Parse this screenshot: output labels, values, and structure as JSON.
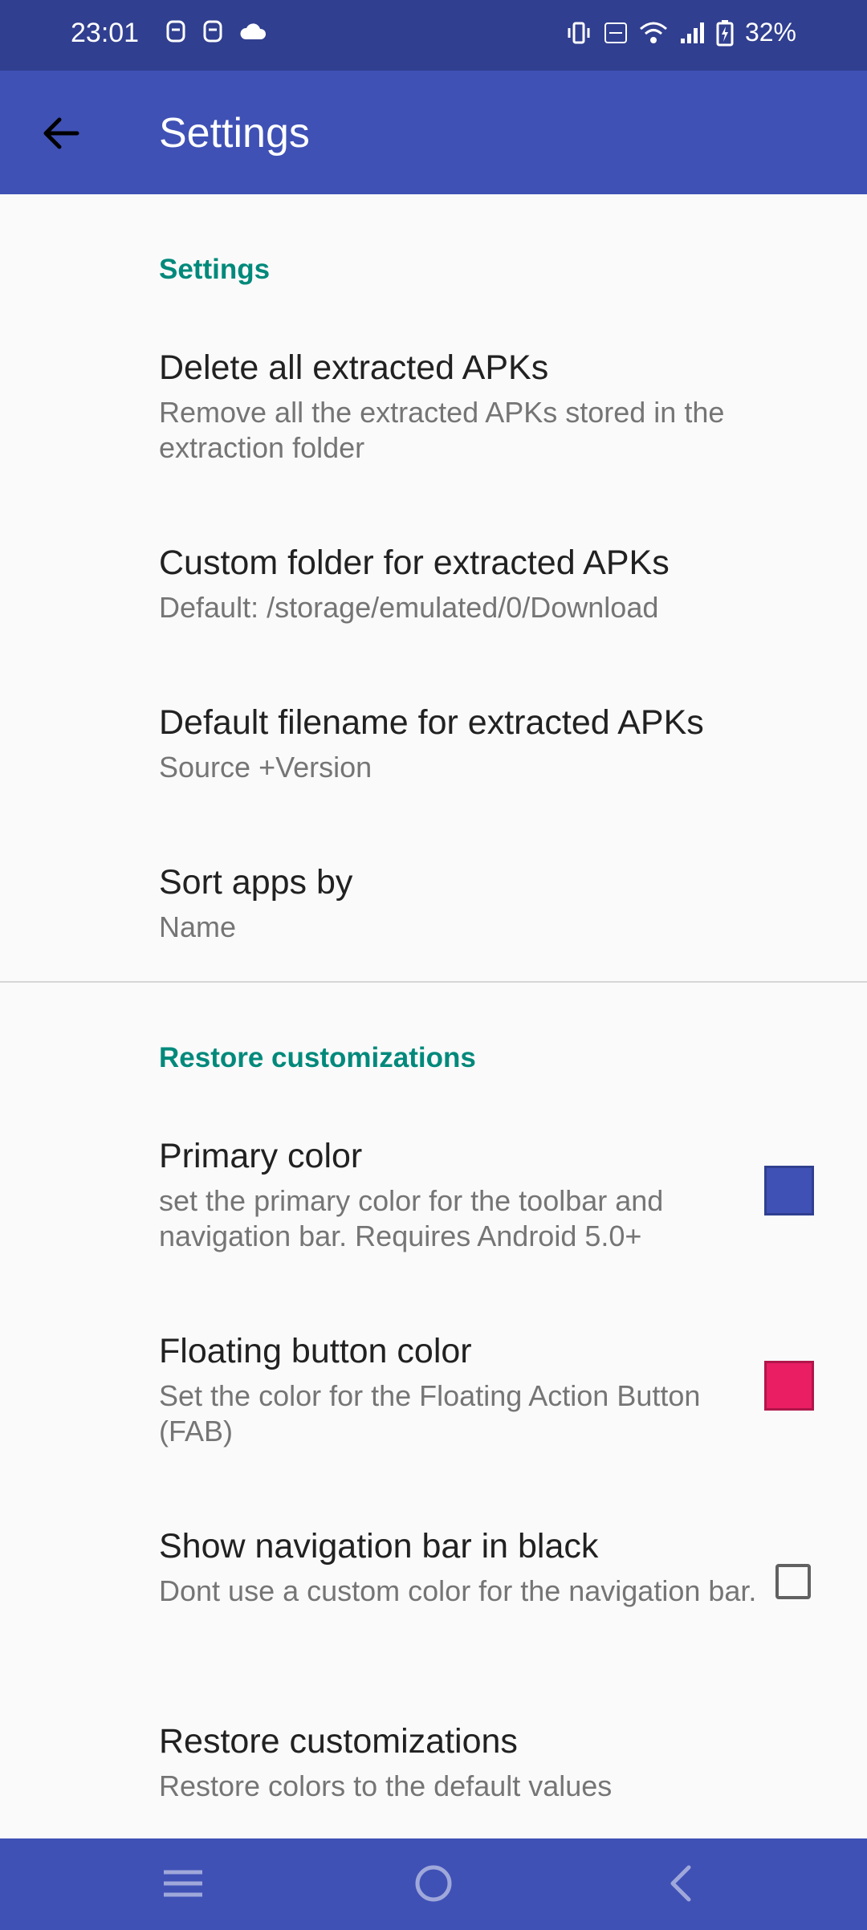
{
  "status_bar": {
    "time": "23:01",
    "battery": "32%"
  },
  "app_bar": {
    "title": "Settings"
  },
  "sections": [
    {
      "header": "Settings"
    },
    {
      "header": "Restore customizations"
    }
  ],
  "prefs": [
    {
      "title": "Delete all extracted APKs",
      "summary": "Remove all the extracted APKs stored in the extraction folder"
    },
    {
      "title": "Custom folder for extracted APKs",
      "summary": "Default: /storage/emulated/0/Download"
    },
    {
      "title": "Default filename for extracted APKs",
      "summary": "Source +Version"
    },
    {
      "title": "Sort apps by",
      "summary": "Name"
    },
    {
      "title": "Primary color",
      "summary": "set the primary color for the toolbar and navigation bar. Requires Android 5.0+"
    },
    {
      "title": "Floating button color",
      "summary": "Set the color for the Floating Action Button (FAB)"
    },
    {
      "title": "Show navigation bar in black",
      "summary": "Dont use a custom color for the navigation bar."
    },
    {
      "title": "Restore customizations",
      "summary": "Restore colors to the default values"
    }
  ],
  "colors": {
    "primary": "#3f51b5",
    "primary_dark": "#303f8f",
    "accent_section": "#00897b",
    "fab": "#e91e63"
  },
  "icons": {
    "back": "arrow-left-icon",
    "nav_menu": "menu-icon",
    "nav_home": "home-circle-icon",
    "nav_back": "chevron-left-icon"
  },
  "show_nav_black_checked": false
}
